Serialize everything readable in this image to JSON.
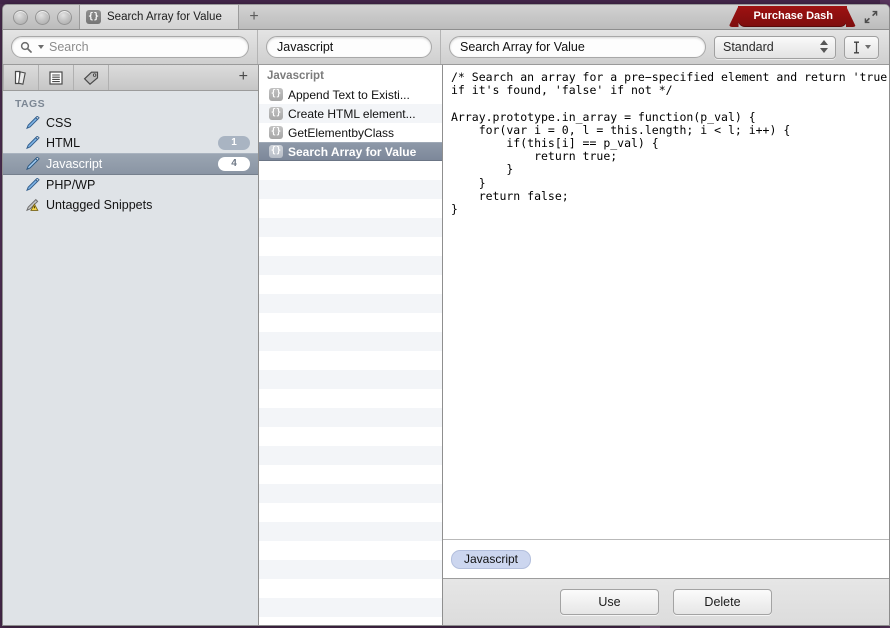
{
  "window": {
    "titlebar": {
      "tab_title": "Search Array for Value",
      "tab_icon": "braces-icon",
      "new_tab_label": "+",
      "purchase_badge": "Purchase Dash",
      "fullscreen_icon": "fullscreen-icon",
      "traffic_lights": [
        "close-button",
        "minimize-button",
        "zoom-button"
      ]
    },
    "toolbar": {
      "search_placeholder": "Search",
      "search_value": "",
      "search_icon": "search-icon",
      "tag_filter_value": "Javascript",
      "snippet_name_value": "Search Array for Value",
      "style_select_value": "Standard",
      "style_select_options": [
        "Standard"
      ],
      "text_tool_icon": "text-cursor-icon"
    }
  },
  "sidebar": {
    "toolbar_icons": [
      "library-icon",
      "list-icon",
      "tag-icon"
    ],
    "add_label": "+",
    "section_header": "TAGS",
    "items": [
      {
        "label": "CSS",
        "icon": "tag-pencil-icon",
        "count": "",
        "selected": false
      },
      {
        "label": "HTML",
        "icon": "tag-pencil-icon",
        "count": "1",
        "selected": false
      },
      {
        "label": "Javascript",
        "icon": "tag-pencil-icon",
        "count": "4",
        "selected": true
      },
      {
        "label": "PHP/WP",
        "icon": "tag-pencil-icon",
        "count": "",
        "selected": false
      },
      {
        "label": "Untagged Snippets",
        "icon": "warning-tag-icon",
        "count": "",
        "selected": false
      }
    ]
  },
  "snippet_list": {
    "group_header": "Javascript",
    "items": [
      {
        "label": "Append Text to Existi...",
        "icon": "braces-icon",
        "selected": false
      },
      {
        "label": "Create HTML element...",
        "icon": "braces-icon",
        "selected": false
      },
      {
        "label": "GetElementbyClass",
        "icon": "braces-icon",
        "selected": false
      },
      {
        "label": "Search Array for Value",
        "icon": "braces-icon",
        "selected": true
      }
    ]
  },
  "detail": {
    "code": "/* Search an array for a pre−specified element and return 'true'\nif it's found, 'false' if not */\n\nArray.prototype.in_array = function(p_val) {\n    for(var i = 0, l = this.length; i < l; i++) {\n        if(this[i] == p_val) {\n            return true;\n        }\n    }\n    return false;\n}",
    "tags": [
      "Javascript"
    ],
    "buttons": [
      {
        "label": "Use"
      },
      {
        "label": "Delete"
      }
    ]
  },
  "colors": {
    "desktop": "#4a2c4f",
    "purchase_badge": "#8d1010",
    "selection": "#8a95a4",
    "tag_chip": "#ccd6ef",
    "badge_inactive": "#a9b4c2"
  }
}
